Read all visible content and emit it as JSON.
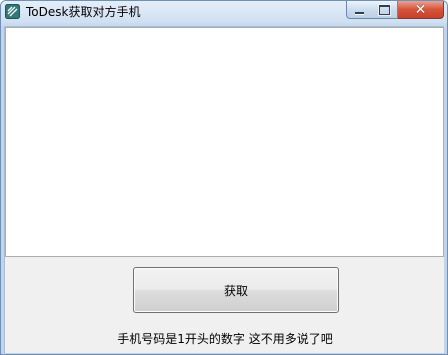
{
  "window": {
    "title": "ToDesk获取对方手机",
    "app_icon": "todesk-logo-icon",
    "controls": {
      "minimize_icon": "minimize-icon",
      "maximize_icon": "maximize-icon",
      "close_icon": "close-icon",
      "close_glyph": "✕"
    }
  },
  "main": {
    "textarea_value": "",
    "button_label": "获取",
    "hint": "手机号码是1开头的数字  这不用多说了吧"
  },
  "colors": {
    "titlebar": "#cfdff1",
    "close_button": "#d5543a",
    "client_bg": "#f0f0f0"
  }
}
